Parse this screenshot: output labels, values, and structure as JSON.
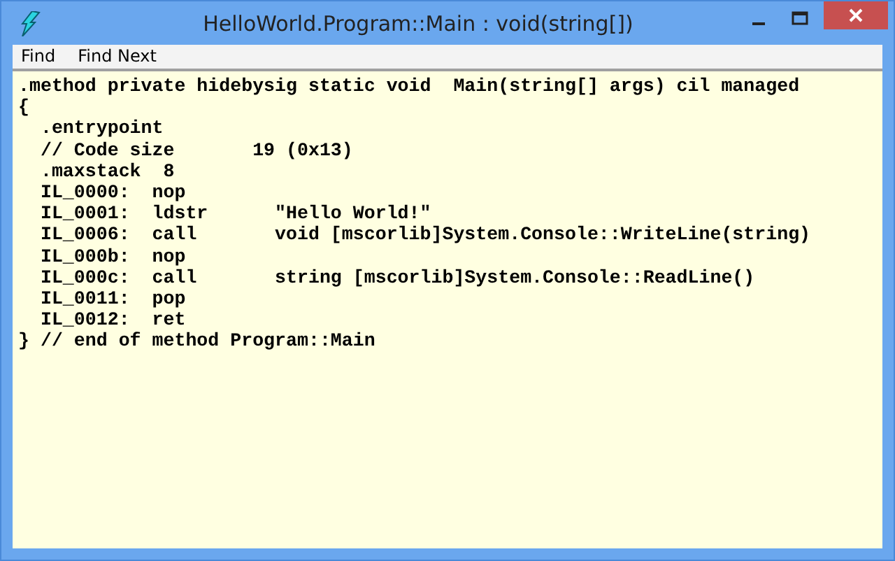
{
  "window": {
    "title": "HelloWorld.Program::Main : void(string[])"
  },
  "menu": [
    "Find",
    "Find Next"
  ],
  "code_lines": [
    ".method private hidebysig static void  Main(string[] args) cil managed",
    "{",
    "  .entrypoint",
    "  // Code size       19 (0x13)",
    "  .maxstack  8",
    "  IL_0000:  nop",
    "  IL_0001:  ldstr      \"Hello World!\"",
    "  IL_0006:  call       void [mscorlib]System.Console::WriteLine(string)",
    "  IL_000b:  nop",
    "  IL_000c:  call       string [mscorlib]System.Console::ReadLine()",
    "  IL_0011:  pop",
    "  IL_0012:  ret",
    "} // end of method Program::Main"
  ]
}
